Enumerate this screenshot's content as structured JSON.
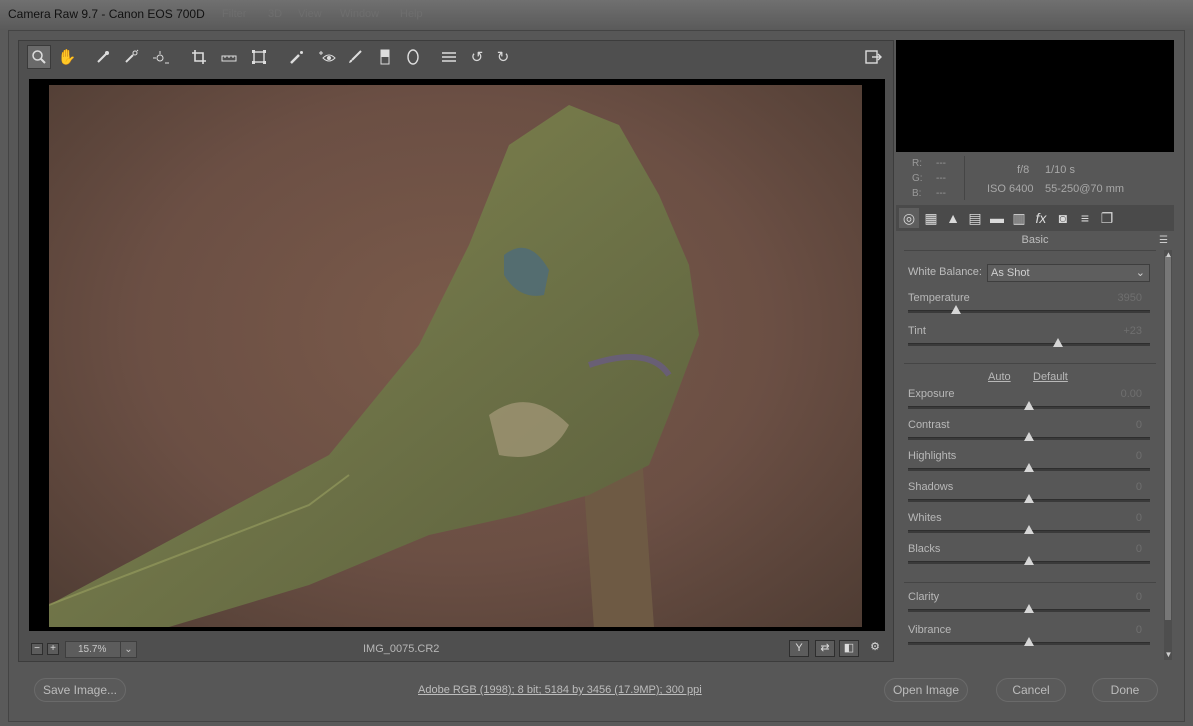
{
  "window": {
    "title": "Camera Raw 9.7  -  Canon EOS 700D",
    "ghost_menus": [
      "Filter",
      "3D",
      "View",
      "Window",
      "Help"
    ]
  },
  "toolbar": {
    "tools": [
      "zoom-tool",
      "hand-tool",
      "white-balance-tool",
      "color-sampler-tool",
      "targeted-adjustment-tool",
      "crop-tool",
      "straighten-tool",
      "transform-tool",
      "spot-removal-tool",
      "red-eye-tool",
      "adjustment-brush",
      "graduated-filter",
      "radial-filter",
      "preferences",
      "rotate-ccw",
      "rotate-cw"
    ],
    "fullscreen": "full-screen-toggle"
  },
  "status": {
    "zoom": "15.7%",
    "filename": "IMG_0075.CR2"
  },
  "view_buttons": [
    "Y",
    "⇄",
    "◧",
    "⚙"
  ],
  "info": {
    "r_label": "R:",
    "g_label": "G:",
    "b_label": "B:",
    "r": "---",
    "g": "---",
    "b": "---",
    "aperture": "f/8",
    "shutter": "1/10 s",
    "iso": "ISO 6400",
    "lens": "55-250@70 mm"
  },
  "panel": {
    "title": "Basic",
    "white_balance_label": "White Balance:",
    "white_balance_value": "As Shot",
    "auto": "Auto",
    "default": "Default",
    "sliders": [
      {
        "label": "Temperature",
        "value": "3950",
        "level": 0.2
      },
      {
        "label": "Tint",
        "value": "+23",
        "level": 0.62
      },
      {
        "label": "Exposure",
        "value": "0.00",
        "level": 0.5
      },
      {
        "label": "Contrast",
        "value": "0",
        "level": 0.5
      },
      {
        "label": "Highlights",
        "value": "0",
        "level": 0.5
      },
      {
        "label": "Shadows",
        "value": "0",
        "level": 0.5
      },
      {
        "label": "Whites",
        "value": "0",
        "level": 0.5
      },
      {
        "label": "Blacks",
        "value": "0",
        "level": 0.5
      },
      {
        "label": "Clarity",
        "value": "0",
        "level": 0.5
      },
      {
        "label": "Vibrance",
        "value": "0",
        "level": 0.5
      }
    ]
  },
  "footer": {
    "save": "Save Image...",
    "workflow": "Adobe RGB (1998); 8 bit; 5184 by 3456 (17.9MP); 300 ppi",
    "open": "Open Image",
    "cancel": "Cancel",
    "done": "Done"
  }
}
